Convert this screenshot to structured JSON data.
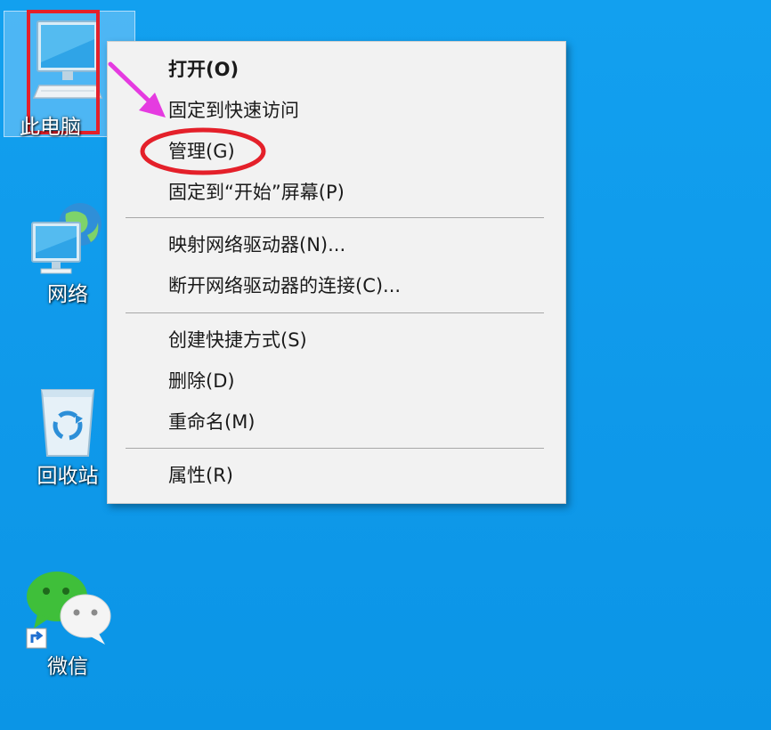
{
  "desktop": {
    "background_color": "#0f99ea",
    "icons": [
      {
        "label": "此电脑",
        "icon": "computer-icon"
      },
      {
        "label": "网络",
        "icon": "network-icon"
      },
      {
        "label": "回收站",
        "icon": "recycle-bin-icon"
      },
      {
        "label": "微信",
        "icon": "wechat-icon"
      }
    ]
  },
  "context_menu": {
    "items": [
      {
        "label": "打开(O)",
        "bold": true
      },
      {
        "label": "固定到快速访问"
      },
      {
        "label": "管理(G)"
      },
      {
        "label": "固定到“开始”屏幕(P)"
      },
      {
        "label": "映射网络驱动器(N)..."
      },
      {
        "label": "断开网络驱动器的连接(C)..."
      },
      {
        "label": "创建快捷方式(S)"
      },
      {
        "label": "删除(D)"
      },
      {
        "label": "重命名(M)"
      },
      {
        "label": "属性(R)"
      }
    ]
  },
  "annotations": {
    "highlight_color": "#e4202a",
    "arrow_color": "#e53be0"
  }
}
